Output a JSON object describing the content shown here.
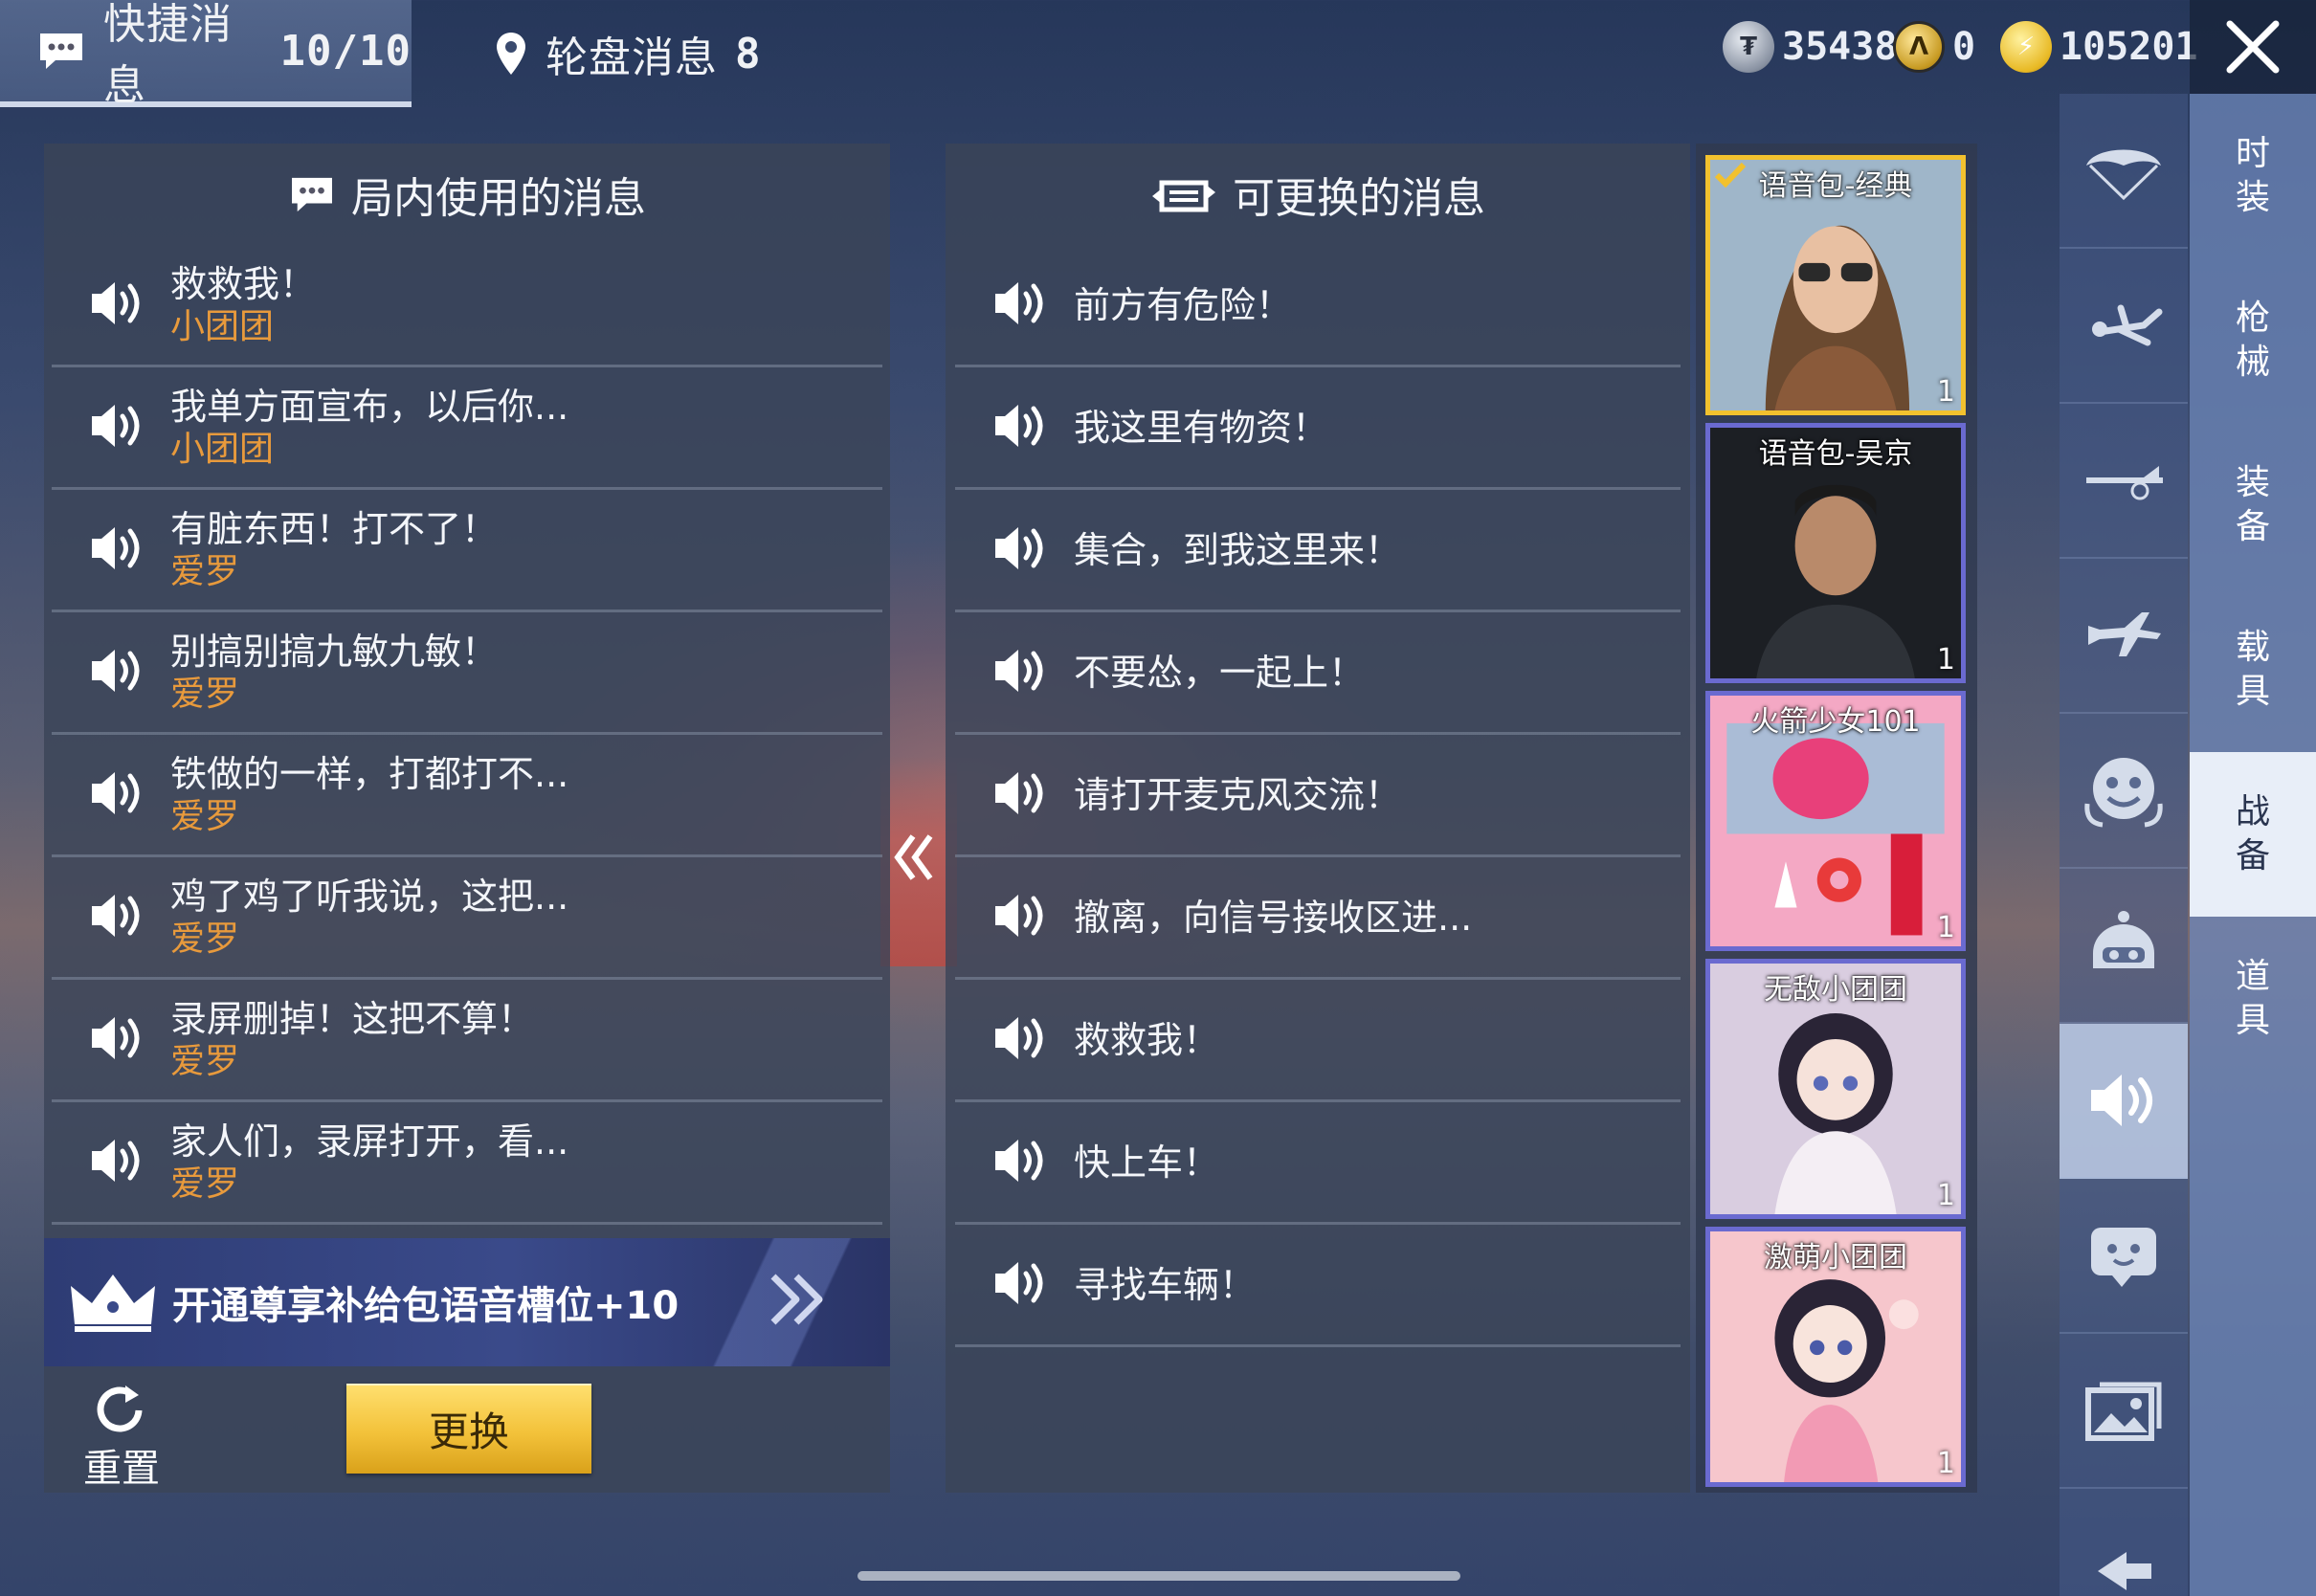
{
  "top_bar": {
    "tab_quick": {
      "label": "快捷消息",
      "count": "10/10"
    },
    "tab_wheel": {
      "label": "轮盘消息",
      "count": "8"
    },
    "currencies": [
      {
        "icon": "silver-coin-icon",
        "value": "35438"
      },
      {
        "icon": "gold-coin-icon",
        "value": "0"
      },
      {
        "icon": "bolt-coin-icon",
        "value": "105201"
      }
    ]
  },
  "in_game": {
    "title": "局内使用的消息",
    "messages": [
      {
        "text": "救救我！",
        "pack": "小团团"
      },
      {
        "text": "我单方面宣布，以后你...",
        "pack": "小团团"
      },
      {
        "text": "有脏东西！打不了！",
        "pack": "爱罗"
      },
      {
        "text": "别搞别搞九敏九敏！",
        "pack": "爱罗"
      },
      {
        "text": "铁做的一样，打都打不...",
        "pack": "爱罗"
      },
      {
        "text": "鸡了鸡了听我说，这把...",
        "pack": "爱罗"
      },
      {
        "text": "录屏删掉！这把不算！",
        "pack": "爱罗"
      },
      {
        "text": "家人们，录屏打开，看...",
        "pack": "爱罗"
      }
    ],
    "promo": "开通尊享补给包语音槽位+10",
    "reset_label": "重置",
    "replace_label": "更换"
  },
  "replaceable": {
    "title": "可更换的消息",
    "messages": [
      "前方有危险！",
      "我这里有物资！",
      "集合，到我这里来！",
      "不要怂，一起上！",
      "请打开麦克风交流！",
      "撤离，向信号接收区进...",
      "救救我！",
      "快上车！",
      "寻找车辆！"
    ]
  },
  "voice_packs": [
    {
      "name": "语音包-经典",
      "count": "1",
      "selected": true
    },
    {
      "name": "语音包-吴京",
      "count": "1",
      "selected": false
    },
    {
      "name": "火箭少女101",
      "count": "1",
      "selected": false
    },
    {
      "name": "无敌小团团",
      "count": "1",
      "selected": false
    },
    {
      "name": "激萌小团团",
      "count": "1",
      "selected": false
    }
  ],
  "icon_rail": [
    "parachute-icon",
    "skydiver-icon",
    "airplane-trail-icon",
    "airplane-icon",
    "emote-face-icon",
    "helmet-icon",
    "voice-speaker-icon",
    "chat-face-icon",
    "gallery-icon",
    "collapse-icon"
  ],
  "categories": [
    "时装",
    "枪械",
    "装备",
    "载具",
    "战备",
    "道具"
  ],
  "active_category": "战备",
  "colors": {
    "accent_orange": "#e89a3c",
    "gold_button": "#f3c23a",
    "selected_border": "#f2c12e"
  }
}
